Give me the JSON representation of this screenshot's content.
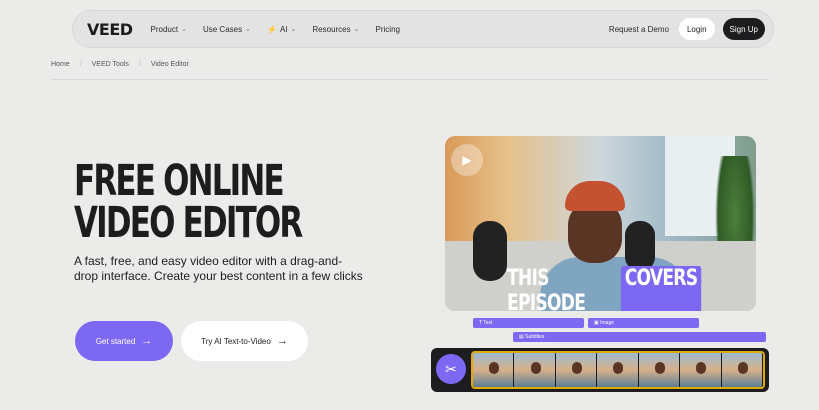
{
  "nav": {
    "logo": "VEED",
    "items": [
      {
        "label": "Product",
        "has_dropdown": true
      },
      {
        "label": "Use Cases",
        "has_dropdown": true
      },
      {
        "label": "AI",
        "has_dropdown": true
      },
      {
        "label": "Resources",
        "has_dropdown": true
      },
      {
        "label": "Pricing",
        "has_dropdown": false
      }
    ],
    "request_demo": "Request a Demo",
    "login": "Login",
    "signup": "Sign Up"
  },
  "breadcrumb": [
    "Home",
    "VEED Tools",
    "Video Editor"
  ],
  "hero": {
    "title": "FREE ONLINE VIDEO EDITOR",
    "subtitle": "A fast, free, and easy video editor with a drag-and-drop interface. Create your best content in a few clicks",
    "primary_cta": "Get started",
    "secondary_cta": "Try AI Text-to-Video"
  },
  "preview": {
    "caption_plain": "THIS EPISODE",
    "caption_highlight": "COVERS",
    "tracks": {
      "text": "Text",
      "image": "Image",
      "subtitles": "Subtitles"
    }
  },
  "colors": {
    "accent": "#7c68f3",
    "background": "#ebebea",
    "dark": "#1d1d1f"
  }
}
